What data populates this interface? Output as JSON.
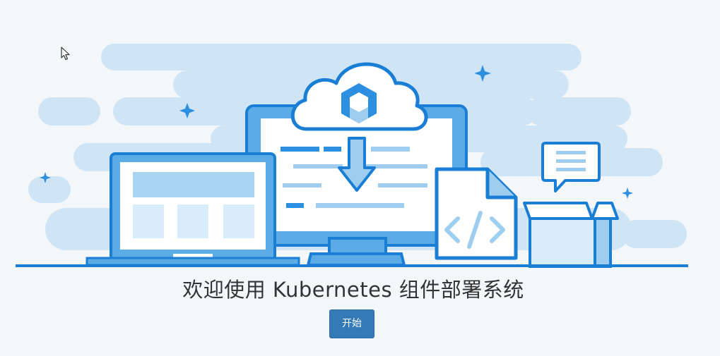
{
  "welcome": {
    "title": "欢迎使用 Kubernetes 组件部署系统",
    "start_label": "开始"
  },
  "colors": {
    "background": "#f4f7fa",
    "cloud_light": "#cfe5f5",
    "primary_blue": "#1a7fd4",
    "mid_blue": "#5aabe6",
    "light_fill": "#d9ecfa",
    "button": "#337ab7"
  },
  "icons": {
    "cursor": "mouse-pointer-icon",
    "logo": "kubernetes-cube-logo",
    "download": "download-arrow-icon",
    "code": "code-file-icon",
    "chat": "chat-bubble-icon",
    "box": "open-box-icon",
    "sparkle": "sparkle-icon"
  }
}
